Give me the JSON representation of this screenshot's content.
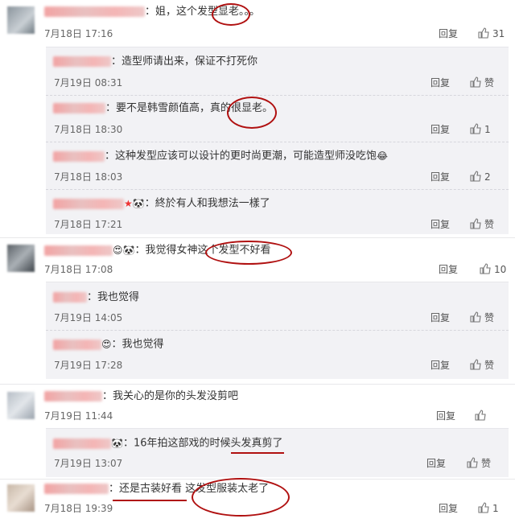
{
  "comments": [
    {
      "text": "：姐，这个发型显老。。。",
      "time": "7月18日 17:16",
      "reply": "回复",
      "likes": "31"
    },
    {
      "text": "：我觉得女神这个发型不好看",
      "time": "7月18日 17:08",
      "reply": "回复",
      "likes": "10"
    },
    {
      "text": "：我关心的是你的头发没剪吧",
      "time": "7月19日 11:44",
      "reply": "回复",
      "likes": ""
    },
    {
      "text": "：还是古装好看 这发型服装太老了",
      "time": "7月18日 19:39",
      "reply": "回复",
      "likes": "1"
    }
  ],
  "replies_1": [
    {
      "text": "：造型师请出来，保证不打死你",
      "time": "7月19日 08:31",
      "reply": "回复",
      "likes": "赞"
    },
    {
      "text": "：要不是韩雪颜值高，真的很显老。",
      "time": "7月18日 18:30",
      "reply": "回复",
      "likes": "1"
    },
    {
      "text": "：这种发型应该可以设计的更时尚更潮，可能造型师没吃饱",
      "time": "7月18日 18:03",
      "reply": "回复",
      "likes": "2"
    },
    {
      "text": "：終於有人和我想法一樣了",
      "time": "7月18日 17:21",
      "reply": "回复",
      "likes": "赞"
    }
  ],
  "replies_2": [
    {
      "text": "：我也觉得",
      "time": "7月19日 14:05",
      "reply": "回复",
      "likes": "赞"
    },
    {
      "text": "：我也觉得",
      "time": "7月19日 17:28",
      "reply": "回复",
      "likes": "赞"
    }
  ],
  "replies_3": [
    {
      "text": "：16年拍这部戏的时候头发真剪了",
      "time": "7月19日 13:07",
      "reply": "回复",
      "likes": "赞"
    }
  ],
  "colors": {
    "annotation": "#b01010",
    "reply_bg": "#f2f2f5"
  }
}
